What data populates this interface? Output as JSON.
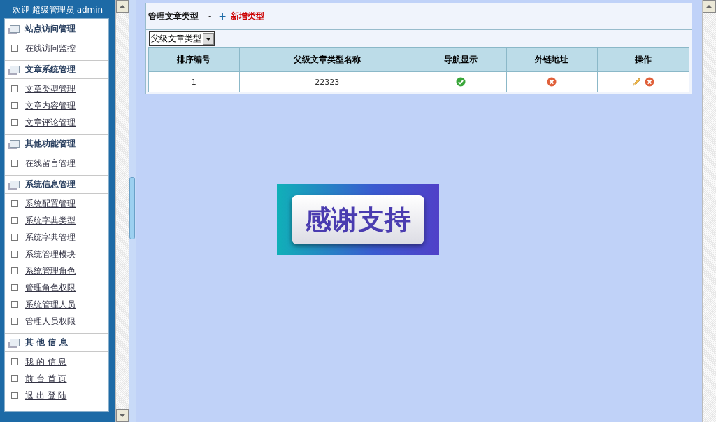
{
  "sidebar": {
    "welcome": "欢迎 超级管理员 admin",
    "groups": [
      {
        "title": "站点访问管理",
        "items": [
          "在线访问监控"
        ]
      },
      {
        "title": "文章系统管理",
        "items": [
          "文章类型管理",
          "文章内容管理",
          "文章评论管理"
        ]
      },
      {
        "title": "其他功能管理",
        "items": [
          "在线留言管理"
        ]
      },
      {
        "title": "系统信息管理",
        "items": [
          "系统配置管理",
          "系统字典类型",
          "系统字典管理",
          "系统管理模块",
          "系统管理角色",
          "管理角色权限",
          "系统管理人员",
          "管理人员权限"
        ]
      },
      {
        "title": "其 他 信 息",
        "items": [
          "我 的 信 息",
          "前 台 首 页",
          "退 出 登 陆"
        ]
      }
    ]
  },
  "panel": {
    "title": "管理文章类型",
    "separator": "-",
    "add_icon": "+",
    "add_link": "新增类型",
    "filter": {
      "value": "父级文章类型"
    },
    "table": {
      "columns": [
        "排序编号",
        "父级文章类型名称",
        "导航显示",
        "外链地址",
        "操作"
      ],
      "rows": [
        {
          "order": "1",
          "name": "22323",
          "nav_shown": true,
          "external_link": false
        }
      ]
    }
  },
  "banner": {
    "text": "感谢支持"
  }
}
